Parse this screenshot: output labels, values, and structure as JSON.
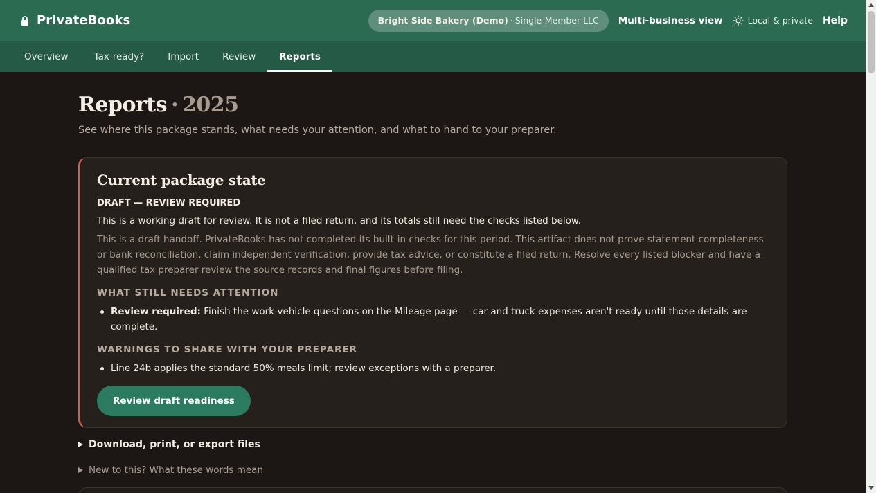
{
  "app": {
    "name": "PrivateBooks",
    "business_name": "Bright Side Bakery (Demo)",
    "business_separator": "·",
    "business_type": "Single-Member LLC",
    "multi_business": "Multi-business view",
    "local_label": "Local & private",
    "help": "Help"
  },
  "tabs": [
    {
      "label": "Overview",
      "active": false
    },
    {
      "label": "Tax-ready?",
      "active": false
    },
    {
      "label": "Import",
      "active": false
    },
    {
      "label": "Review",
      "active": false
    },
    {
      "label": "Reports",
      "active": true
    }
  ],
  "page": {
    "title": "Reports",
    "title_separator": "·",
    "year": "2025",
    "subtitle": "See where this package stands, what needs your attention, and what to hand to your preparer."
  },
  "card": {
    "title": "Current package state",
    "state": "DRAFT — REVIEW REQUIRED",
    "lead": "This is a working draft for review. It is not a filed return, and its totals still need the checks listed below.",
    "body": "This is a draft handoff. PrivateBooks has not completed its built-in checks for this period. This artifact does not prove statement completeness or bank reconciliation, claim independent verification, provide tax advice, or constitute a filed return. Resolve every listed blocker and have a qualified tax preparer review the source records and final figures before filing.",
    "attention_heading": "What still needs attention",
    "attention_items": [
      {
        "strong": "Review required:",
        "text": " Finish the work-vehicle questions on the Mileage page — car and truck expenses aren't ready until those details are complete."
      }
    ],
    "warnings_heading": "Warnings to share with your preparer",
    "warning_items": [
      "Line 24b applies the standard 50% meals limit; review exceptions with a preparer."
    ],
    "cta": "Review draft readiness"
  },
  "disclosures": {
    "download": "Download, print, or export files",
    "glossary": "New to this? What these words mean"
  },
  "colors": {
    "header": "#2a6b52",
    "tabbar": "#245a46",
    "accent_border": "#c8614e",
    "button": "#2a7b5f",
    "background": "#1c1714"
  }
}
